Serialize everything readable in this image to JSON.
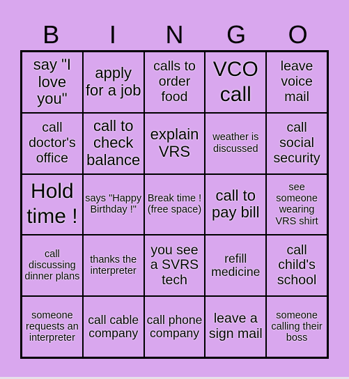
{
  "header": [
    "B",
    "I",
    "N",
    "G",
    "O"
  ],
  "colors": {
    "background": "#d9a7ee",
    "grid_line": "#000000",
    "text": "#000000"
  },
  "cells": [
    "say \"I love you\"",
    "apply for a job",
    "calls to order food",
    "VCO call",
    "leave voice mail",
    "call doctor's office",
    "call to check balance",
    "explain VRS",
    "weather is discussed",
    "call social security",
    "Hold time !",
    "says \"Happy Birthday !\"",
    "Break time ! (free space)",
    "call to pay bill",
    "see someone wearing VRS shirt",
    "call discussing dinner plans",
    "thanks the interpreter",
    "you see a SVRS tech",
    "refill medicine",
    "call child's school",
    "someone requests an interpreter",
    "call cable company",
    "call phone company",
    "leave a sign mail",
    "someone calling their boss"
  ]
}
